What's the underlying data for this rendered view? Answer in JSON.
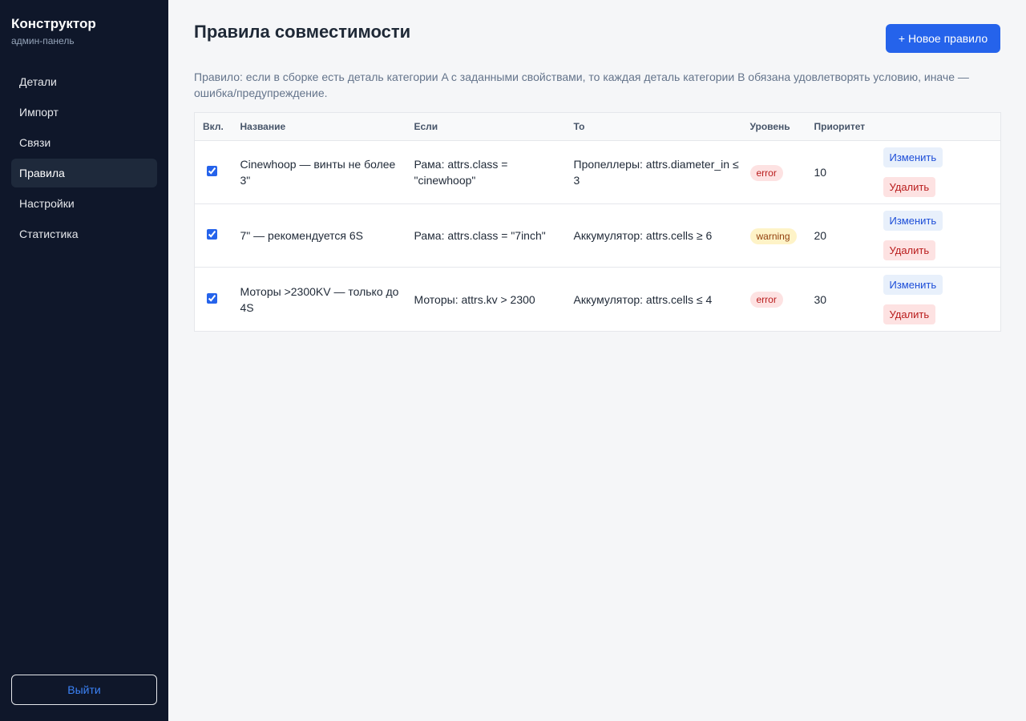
{
  "sidebar": {
    "brand_title": "Конструктор",
    "brand_sub": "админ-панель",
    "items": [
      {
        "label": "Детали"
      },
      {
        "label": "Импорт"
      },
      {
        "label": "Связи"
      },
      {
        "label": "Правила"
      },
      {
        "label": "Настройки"
      },
      {
        "label": "Статистика"
      }
    ],
    "active": "Правила",
    "logout_label": "Выйти"
  },
  "main": {
    "title": "Правила совместимости",
    "new_rule_label": "+ Новое правило",
    "description": "Правило: если в сборке есть деталь категории A с заданными свойствами, то каждая деталь категории B обязана удовлетворять условию, иначе — ошибка/предупреждение.",
    "columns": [
      "Вкл.",
      "Название",
      "Если",
      "То",
      "Уровень",
      "Приоритет",
      ""
    ],
    "rows": [
      {
        "enabled": true,
        "name": "Cinewhoop — винты не более 3\"",
        "if": "Рама: attrs.class = \"cinewhoop\"",
        "then": "Пропеллеры: attrs.diameter_in ≤ 3",
        "level": "error",
        "priority": "10"
      },
      {
        "enabled": true,
        "name": "7\" — рекомендуется 6S",
        "if": "Рама: attrs.class = \"7inch\"",
        "then": "Аккумулятор: attrs.cells ≥ 6",
        "level": "warning",
        "priority": "20"
      },
      {
        "enabled": true,
        "name": "Моторы >2300KV — только до 4S",
        "if": "Моторы: attrs.kv > 2300",
        "then": "Аккумулятор: attrs.cells ≤ 4",
        "level": "error",
        "priority": "30"
      }
    ],
    "edit_label": "Изменить",
    "delete_label": "Удалить"
  },
  "colors": {
    "sidebar_bg": "#0f172a",
    "accent": "#2563eb",
    "error_badge": "#fde2e2",
    "warning_badge": "#fef3c7"
  }
}
